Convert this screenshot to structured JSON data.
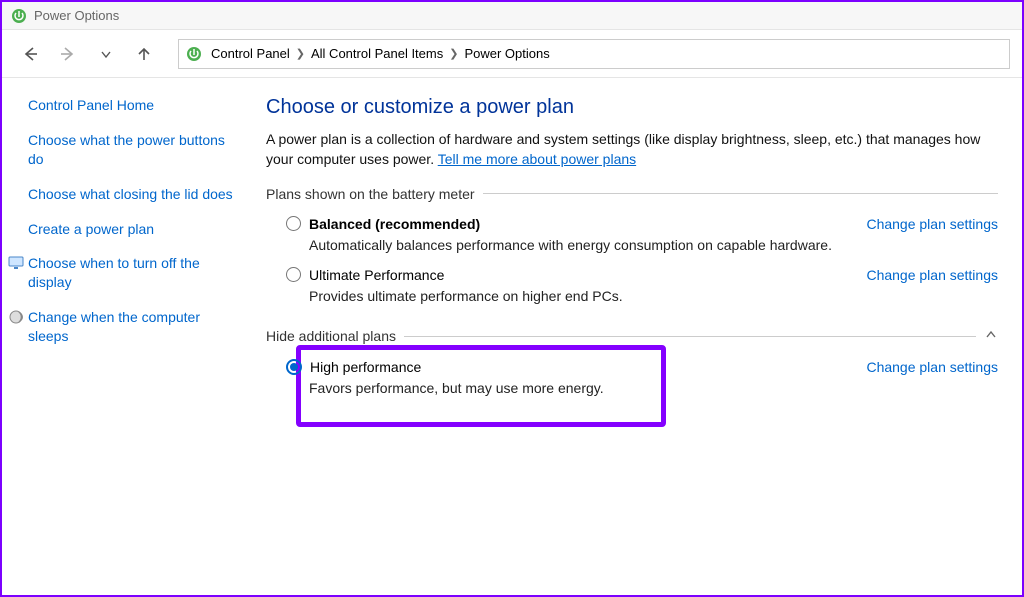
{
  "window": {
    "title": "Power Options"
  },
  "breadcrumb": {
    "items": [
      "Control Panel",
      "All Control Panel Items",
      "Power Options"
    ]
  },
  "sidebar": {
    "home": "Control Panel Home",
    "links": [
      "Choose what the power buttons do",
      "Choose what closing the lid does",
      "Create a power plan",
      "Choose when to turn off the display",
      "Change when the computer sleeps"
    ]
  },
  "main": {
    "heading": "Choose or customize a power plan",
    "desc_prefix": "A power plan is a collection of hardware and system settings (like display brightness, sleep, etc.) that manages how your computer uses power. ",
    "desc_link": "Tell me more about power plans",
    "section1": "Plans shown on the battery meter",
    "section2": "Hide additional plans",
    "change_link": "Change plan settings",
    "plans": [
      {
        "name": "Balanced (recommended)",
        "desc": "Automatically balances performance with energy consumption on capable hardware.",
        "selected": false,
        "bold": true
      },
      {
        "name": "Ultimate Performance",
        "desc": "Provides ultimate performance on higher end PCs.",
        "selected": false,
        "bold": false
      }
    ],
    "additional": [
      {
        "name": "High performance",
        "desc": "Favors performance, but may use more energy.",
        "selected": true,
        "bold": false
      }
    ]
  }
}
